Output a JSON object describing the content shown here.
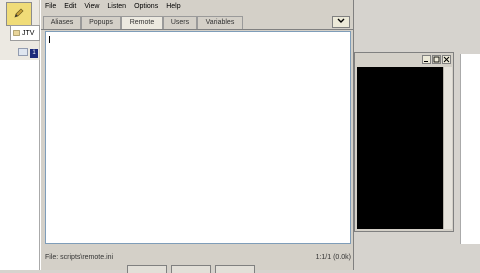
{
  "app": {
    "menu": [
      "File",
      "Edit",
      "View",
      "Listen",
      "Options",
      "Help"
    ],
    "tabs": [
      "Aliases",
      "Popups",
      "Remote",
      "Users",
      "Variables"
    ],
    "active_tab": "Remote",
    "status_file": "File: scripts\\remote.ini",
    "status_pos": "1:1/1 (0.0k)"
  },
  "sidebar": {
    "cmd_label": "JTV",
    "tree_node": "1"
  },
  "colors": {
    "toolbar_icon_bg": "#f0dc78",
    "tree_node": "#1c2a7a",
    "editor_border": "#7f9db9"
  },
  "icons": [
    "pencil-icon",
    "folder-icon",
    "tree-node-icon",
    "chevron-down-icon",
    "minimize-icon",
    "maximize-icon",
    "close-icon"
  ]
}
